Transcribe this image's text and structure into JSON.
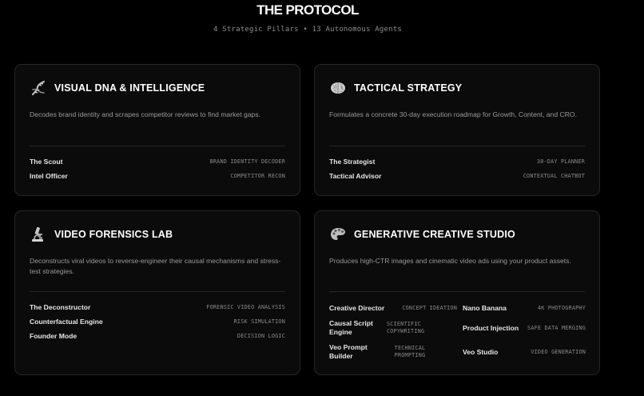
{
  "header": {
    "title": "THE PROTOCOL",
    "subtitle": "4 Strategic Pillars • 13 Autonomous Agents"
  },
  "cards": [
    {
      "icon": "dna-icon",
      "title": "VISUAL DNA & INTELLIGENCE",
      "description": "Decodes brand identity and scrapes competitor reviews to find market gaps.",
      "agents": [
        {
          "name": "The Scout",
          "tag": "BRAND IDENTITY DECODER"
        },
        {
          "name": "Intel Officer",
          "tag": "COMPETITOR RECON"
        }
      ]
    },
    {
      "icon": "brain-icon",
      "title": "TACTICAL STRATEGY",
      "description": "Formulates a concrete 30-day execution roadmap for Growth, Content, and CRO.",
      "agents": [
        {
          "name": "The Strategist",
          "tag": "30-DAY PLANNER"
        },
        {
          "name": "Tactical Advisor",
          "tag": "CONTEXTUAL CHATBOT"
        }
      ]
    },
    {
      "icon": "microscope-icon",
      "title": "VIDEO FORENSICS LAB",
      "description": "Deconstructs viral videos to reverse-engineer their causal mechanisms and stress-test strategies.",
      "agents": [
        {
          "name": "The Deconstructor",
          "tag": "FORENSIC VIDEO ANALYSIS"
        },
        {
          "name": "Counterfactual Engine",
          "tag": "RISK SIMULATION"
        },
        {
          "name": "Founder Mode",
          "tag": "DECISION LOGIC"
        }
      ]
    },
    {
      "icon": "palette-icon",
      "title": "GENERATIVE CREATIVE STUDIO",
      "description": "Produces high-CTR images and cinematic video ads using your product assets.",
      "agents": [
        {
          "name": "Creative Director",
          "tag": "CONCEPT IDEATION"
        },
        {
          "name": "Nano Banana",
          "tag": "4K PHOTOGRAPHY"
        },
        {
          "name": "Causal Script Engine",
          "tag": "SCIENTIFIC COPYWRITING"
        },
        {
          "name": "Product Injection",
          "tag": "SAFE DATA MERGING"
        },
        {
          "name": "Veo Prompt Builder",
          "tag": "TECHNICAL PROMPTING"
        },
        {
          "name": "Veo Studio",
          "tag": "VIDEO GENERATION"
        }
      ]
    }
  ]
}
